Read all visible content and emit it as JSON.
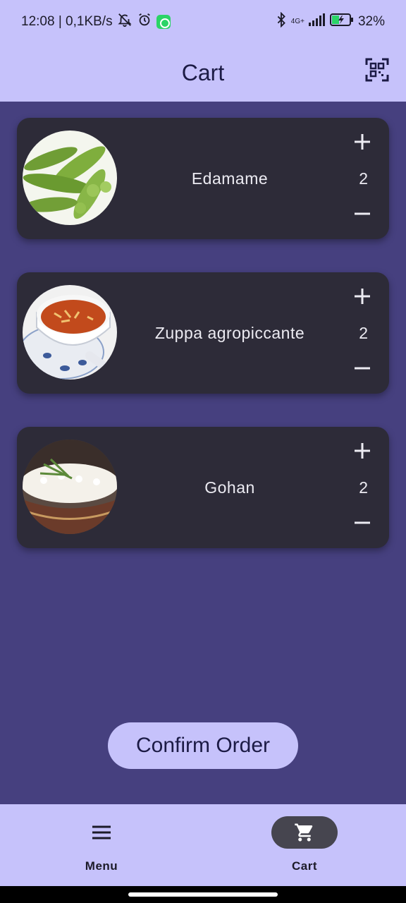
{
  "status_bar": {
    "time_speed": "12:08 | 0,1KB/s",
    "network": "4G+",
    "battery": "32%",
    "icons": [
      "mute-bell-icon",
      "alarm-icon",
      "whatsapp-icon",
      "bluetooth-icon",
      "signal-icon",
      "battery-charging-icon"
    ]
  },
  "app_bar": {
    "title": "Cart",
    "action_icon": "qr-scan-icon"
  },
  "cart": {
    "items": [
      {
        "name": "Edamame",
        "quantity": "2"
      },
      {
        "name": "Zuppa agropiccante",
        "quantity": "2"
      },
      {
        "name": "Gohan",
        "quantity": "2"
      }
    ],
    "confirm_label": "Confirm Order"
  },
  "bottom_nav": {
    "items": [
      {
        "label": "Menu",
        "icon": "hamburger-menu-icon",
        "active": false
      },
      {
        "label": "Cart",
        "icon": "shopping-cart-icon",
        "active": true
      }
    ]
  },
  "colors": {
    "header_bg": "#c6c2fb",
    "content_bg": "#46407f",
    "card_bg": "#2d2b38",
    "button_bg": "#c6c2fb",
    "active_pill": "#46454f"
  }
}
